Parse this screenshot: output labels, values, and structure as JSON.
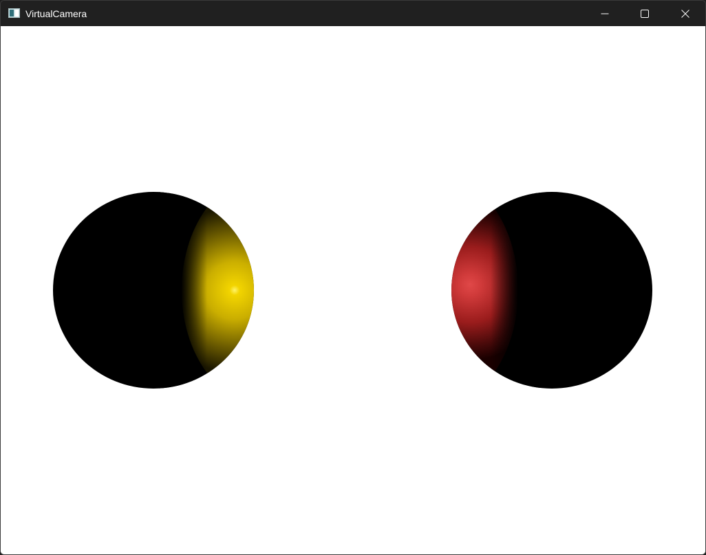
{
  "window": {
    "title": "VirtualCamera",
    "icon": "console-window-icon",
    "controls": {
      "minimize_icon": "minimize-icon",
      "maximize_icon": "maximize-icon",
      "close_icon": "close-icon"
    }
  },
  "scene": {
    "background_color": "#ffffff",
    "spheres": [
      {
        "name": "yellow-sphere",
        "color": "#d4b800",
        "lit_side": "right",
        "shadow_color": "#000000"
      },
      {
        "name": "red-sphere",
        "color": "#c0282a",
        "lit_side": "left",
        "shadow_color": "#000000"
      }
    ]
  }
}
